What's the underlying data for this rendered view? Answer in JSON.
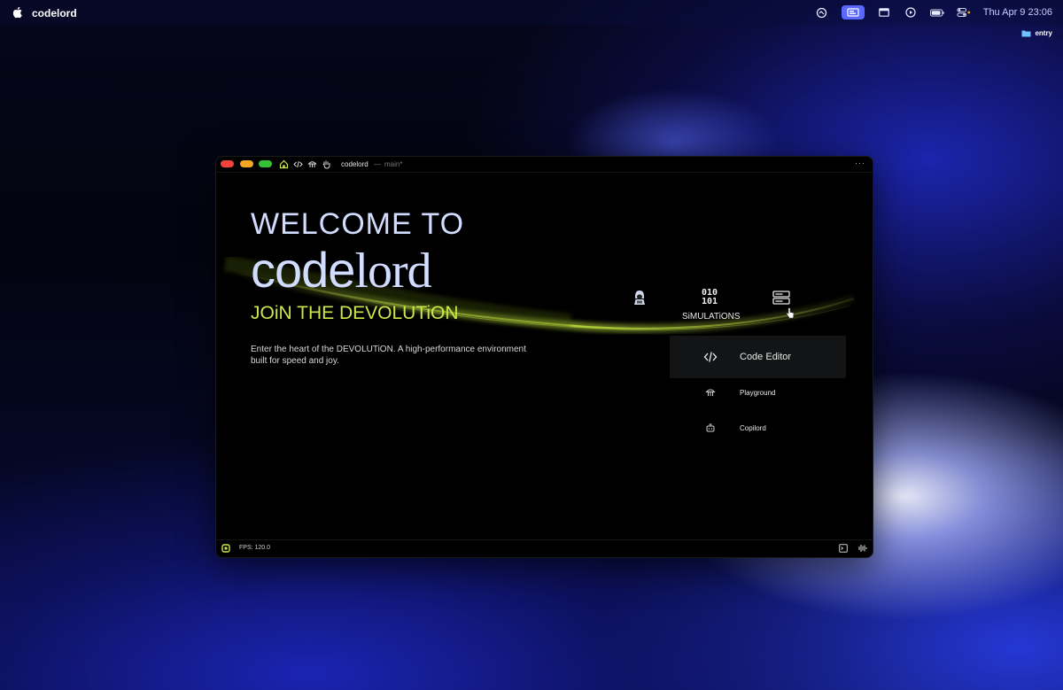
{
  "menubar": {
    "app_name": "codelord",
    "clock": "Thu Apr 9  23:06",
    "icons": [
      "status-icon",
      "screen-share-icon",
      "window-icon",
      "play-icon",
      "battery-icon",
      "control-center-icon"
    ]
  },
  "desktop": {
    "folder_label": "entry"
  },
  "window": {
    "title": "codelord",
    "separator": "—",
    "branch": "main*",
    "more": "···"
  },
  "hero": {
    "welcome": "WELCOME TO",
    "brand_bold": "code",
    "brand_light": "lord",
    "tagline": "JOiN THE DEVOLUTiON",
    "description": "Enter the heart of the DEVOLUTiON. A high-performance environment built for speed and joy."
  },
  "nav": {
    "simulations_top": "010",
    "simulations_bottom": "101",
    "simulations_label": "SiMULATiONS"
  },
  "menu": {
    "items": [
      {
        "label": "Code Editor",
        "icon": "code-icon",
        "active": true
      },
      {
        "label": "Playground",
        "icon": "playground-icon",
        "active": false
      },
      {
        "label": "Copilord",
        "icon": "robot-icon",
        "active": false
      }
    ]
  },
  "statusbar": {
    "fps": "FPS: 120.0"
  },
  "colors": {
    "accent_green": "#cbe84a",
    "heading_blue": "#d2dcff",
    "traffic_red": "#f2433a",
    "traffic_yellow": "#f6a623",
    "traffic_green": "#35c137"
  }
}
